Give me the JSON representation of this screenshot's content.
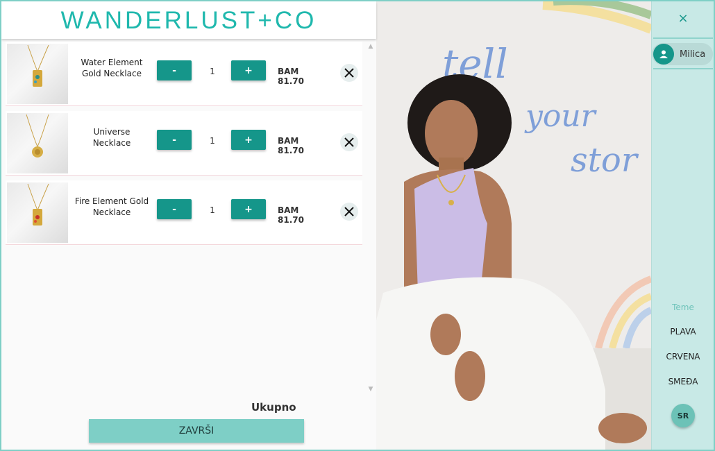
{
  "header": {
    "logo_text": "WANDERLUST+CO"
  },
  "cart": {
    "items": [
      {
        "name_line1": "Water Element",
        "name_line2": "Gold Necklace",
        "minus": "-",
        "plus": "+",
        "qty": "1",
        "price": "BAM 81.70"
      },
      {
        "name_line1": "Universe",
        "name_line2": "Necklace",
        "minus": "-",
        "plus": "+",
        "qty": "1",
        "price": "BAM 81.70"
      },
      {
        "name_line1": "Fire Element Gold",
        "name_line2": "Necklace",
        "minus": "-",
        "plus": "+",
        "qty": "1",
        "price": "BAM 81.70"
      }
    ],
    "total_label": "Ukupno",
    "finish_label": "ZAVRŠI"
  },
  "photo": {
    "handwriting_1": "tell",
    "handwriting_2": "your",
    "handwriting_3": "stor"
  },
  "sidebar": {
    "close_glyph": "×",
    "user_name": "Milica",
    "themes_title": "Teme",
    "themes": [
      "PLAVA",
      "CRVENA",
      "SMEĐA"
    ],
    "language": "SR"
  },
  "colors": {
    "accent": "#15968a",
    "accent_light": "#7ecfc6",
    "sidebar_bg": "#c8e9e6",
    "logo": "#1fb8ad"
  },
  "icons": {
    "remove": "close-icon",
    "avatar": "user-icon",
    "close_sidebar": "close-icon"
  }
}
